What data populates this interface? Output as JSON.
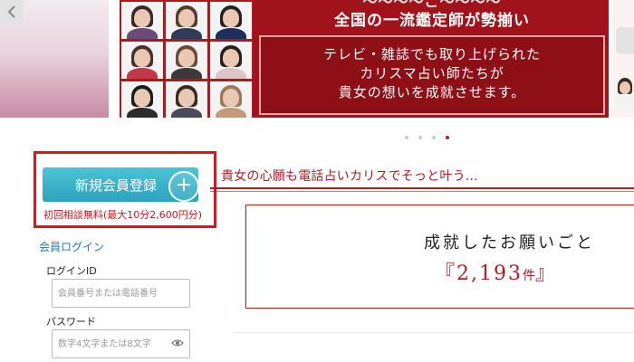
{
  "banner": {
    "top_fragment": "〜〜〜〜ご〜〜〜〜",
    "headline": "全国の一流鑑定師が勢揃い",
    "box_lines": [
      "テレビ・雑誌でも取り上げられた",
      "カリスマ占い師たちが",
      "貴女の想いを成就させます。"
    ],
    "photos": [
      {
        "hair": "#3b2a24",
        "body": "#6b4b7a"
      },
      {
        "hair": "#5a3c2c",
        "body": "#2f3c57"
      },
      {
        "hair": "#222222",
        "body": "#1b2f5a"
      },
      {
        "hair": "#4a2f25",
        "body": "#c23a4a"
      },
      {
        "hair": "#6b4a35",
        "body": "#3a3a3a"
      },
      {
        "hair": "#2a1f1c",
        "body": "#d9c7c9"
      },
      {
        "hair": "#1c1c1c",
        "body": "#2c2c2c"
      },
      {
        "hair": "#3a2a22",
        "body": "#4a4a5a"
      },
      {
        "hair": "#a07654",
        "body": "#c49a7b"
      }
    ],
    "slide_count": 4,
    "active_slide": 4
  },
  "registration": {
    "button_label": "新規会員登録",
    "note": "初回相談無料(最大10分2,600円分)"
  },
  "login": {
    "heading": "会員ログイン",
    "id_label": "ログインID",
    "id_placeholder": "会員番号または電話番号",
    "password_label": "パスワード",
    "password_placeholder": "数字4文字または8文字"
  },
  "main": {
    "tagline": "貴女の心願も電話占いカリスでそっと叶う…",
    "stat_title": "成就したお願いごと",
    "stat_open": "『",
    "stat_value": "2,193",
    "stat_unit": "件",
    "stat_close": "』"
  },
  "colors": {
    "brand_red": "#b31b22",
    "banner_red": "#a1131b",
    "highlight_red": "#e1121b",
    "button_teal": "#2aa3bd",
    "link_blue": "#1f76b3"
  }
}
